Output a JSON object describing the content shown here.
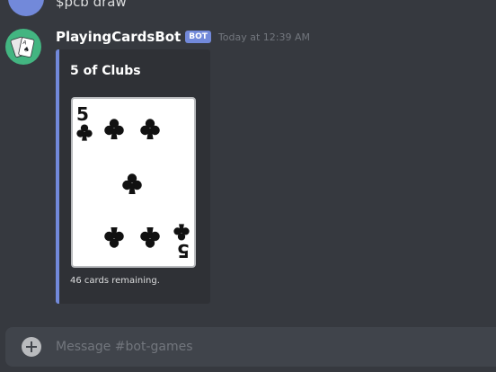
{
  "previous_message": {
    "text": "$pcb draw"
  },
  "message": {
    "username": "PlayingCardsBot",
    "badge": "BOT",
    "timestamp": "Today at 12:39 AM",
    "avatar_icon": "playing-cards-icon"
  },
  "embed": {
    "title": "5 of Clubs",
    "footer": "46 cards remaining.",
    "accent_color": "#7289da",
    "card": {
      "rank": "5",
      "suit": "clubs",
      "pip_count": 5
    }
  },
  "composer": {
    "placeholder": "Message #bot-games"
  },
  "colors": {
    "background": "#36393f",
    "embed_background": "#2f3136",
    "blurple": "#7289da",
    "avatar_green": "#43b581",
    "timestamp": "#72767d"
  }
}
